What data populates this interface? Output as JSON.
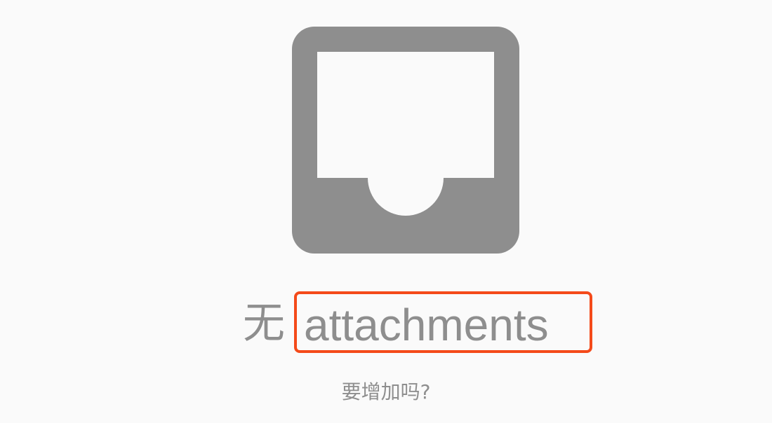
{
  "empty_state": {
    "icon": "inbox-tray-icon",
    "title_prefix": "无",
    "title_word": "attachments",
    "subtitle": "要增加吗?"
  },
  "colors": {
    "background": "#fafafa",
    "icon": "#8e8e8e",
    "text": "#8e8e8e",
    "highlight_border": "#f44a1a"
  }
}
